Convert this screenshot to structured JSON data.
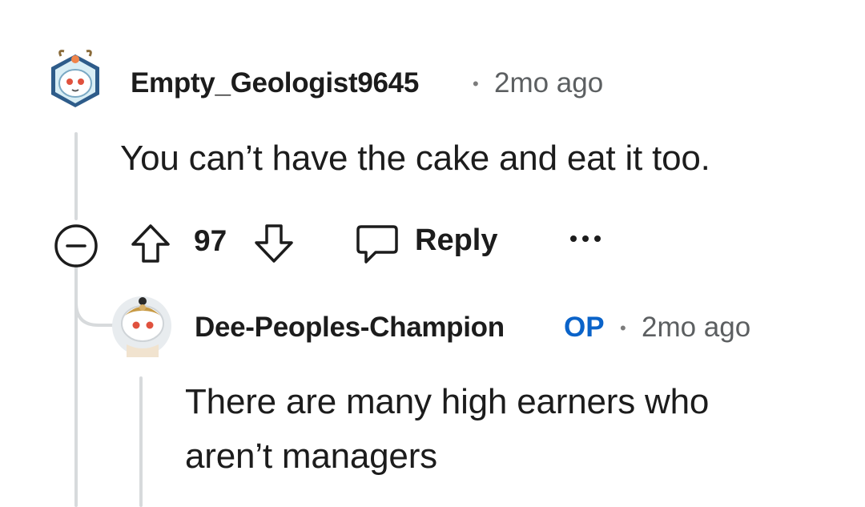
{
  "comments": [
    {
      "username": "Empty_Geologist9645",
      "separator": "•",
      "timestamp": "2mo ago",
      "body": "You can’t have the cake and eat it too.",
      "avatar_icon": "snow-leopard-avatar-icon",
      "actions": {
        "collapse_icon": "collapse-minus-icon",
        "upvote_icon": "upvote-arrow-icon",
        "score": "97",
        "downvote_icon": "downvote-arrow-icon",
        "reply_icon": "reply-bubble-icon",
        "reply_label": "Reply",
        "more_icon": "more-dots-icon"
      }
    },
    {
      "username": "Dee-Peoples-Champion",
      "badge": "OP",
      "separator": "•",
      "timestamp": "2mo ago",
      "body_lines": [
        "There are many high earners who",
        "aren’t managers"
      ],
      "avatar_icon": "snoo-monkey-king-avatar-icon"
    }
  ],
  "colors": {
    "text": "#1c1c1c",
    "meta": "#5c5f61",
    "op_badge": "#0a63c9",
    "thread_line": "#d7dadc"
  }
}
